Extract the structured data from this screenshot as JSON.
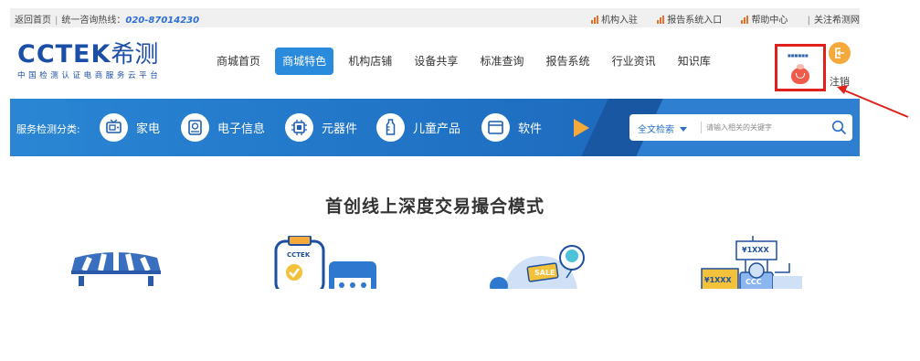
{
  "topbar": {
    "home_link": "返回首页",
    "hotline_label": "统一咨询热线：",
    "hotline_number": "020-87014230",
    "links": [
      {
        "label": "机构入驻"
      },
      {
        "label": "报告系统入口"
      },
      {
        "label": "帮助中心"
      }
    ],
    "follow_label": "关注希测网"
  },
  "logo": {
    "latin": "CCTEK",
    "chinese": "希测",
    "tagline": "中国检测认证电商服务云平台"
  },
  "nav": {
    "items": [
      {
        "label": "商城首页",
        "active": false
      },
      {
        "label": "商城特色",
        "active": true
      },
      {
        "label": "机构店铺",
        "active": false
      },
      {
        "label": "设备共享",
        "active": false
      },
      {
        "label": "标准查询",
        "active": false
      },
      {
        "label": "报告系统",
        "active": false
      },
      {
        "label": "行业资讯",
        "active": false
      },
      {
        "label": "知识库",
        "active": false
      }
    ]
  },
  "user": {
    "mini_text": "■■■■■■",
    "logout_label": "注销"
  },
  "categories": {
    "title": "服务检测分类:",
    "items": [
      {
        "label": "家电",
        "icon": "tv-icon"
      },
      {
        "label": "电子信息",
        "icon": "hard-drive-icon"
      },
      {
        "label": "元器件",
        "icon": "chip-icon"
      },
      {
        "label": "儿童产品",
        "icon": "baby-bottle-icon"
      },
      {
        "label": "软件",
        "icon": "window-icon"
      }
    ]
  },
  "search": {
    "type_label": "全文检索",
    "placeholder": "请输入相关的关键字"
  },
  "main": {
    "headline": "首创线上深度交易撮合模式",
    "illustrations": [
      {
        "icon": "market-stall-icon"
      },
      {
        "icon": "clipboard-check-icon",
        "badge": "CCTEK"
      },
      {
        "icon": "sale-tag-icon",
        "badge": "SALE"
      },
      {
        "icon": "price-tag-icon",
        "prices": [
          "¥1XXX",
          "¥1XXX"
        ],
        "badge": "CCC"
      }
    ]
  },
  "colors": {
    "brand_blue": "#1b4ea6",
    "category_bar": "#2a86d4",
    "nav_active": "#2a8adb",
    "accent_orange": "#f4a93a",
    "annotation_red": "#e0201d"
  }
}
